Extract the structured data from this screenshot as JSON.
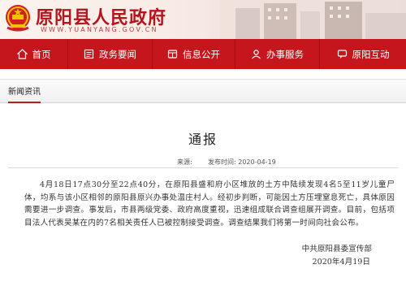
{
  "header": {
    "title": "原阳县人民政府",
    "domain": "WWW.YUANYANG.GOV.CN"
  },
  "nav": {
    "items": [
      {
        "label": "首页",
        "icon": "home-icon"
      },
      {
        "label": "政务要闻",
        "icon": "news-icon"
      },
      {
        "label": "信息公开",
        "icon": "info-icon"
      },
      {
        "label": "办事服务",
        "icon": "service-icon"
      },
      {
        "label": "原阳互动",
        "icon": "chat-icon"
      }
    ]
  },
  "section": {
    "tab_label": "新闻资讯"
  },
  "article": {
    "title": "通报",
    "source_label": "来源:",
    "date_label": "发布时间:",
    "date": "2020-04-19",
    "body": "4月18日17点30分至22点40分，在原阳县盛和府小区堆放的土方中陆续发现4名5至11岁儿童尸体，均系与该小区相邻的原阳县原兴办事处温庄村人。经初步判断，可能因土方压埋窒息死亡，具体原因需要进一步调查。事发后，市县两级党委、政府高度重视，迅速组成联合调查组展开调查。目前，包括项目法人代表吴某在内的7名相关责任人已被控制接受调查。调查结果我们将第一时间向社会公布。",
    "signature_org": "中共原阳县委宣传部",
    "signature_date": "2020年4月19日"
  },
  "colors": {
    "brand_red": "#c4161c",
    "title_red": "#b5141c"
  }
}
